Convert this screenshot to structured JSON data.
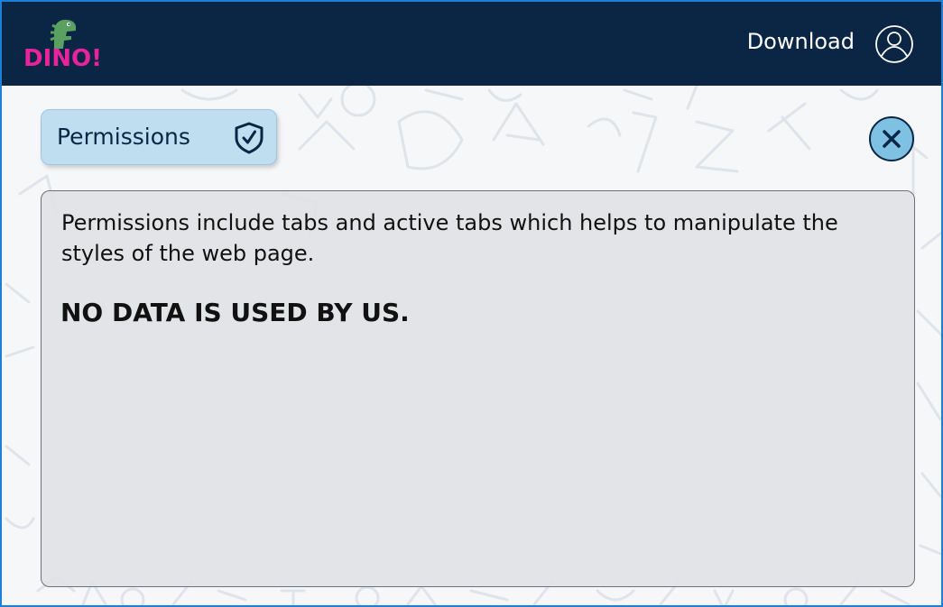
{
  "header": {
    "logo_text": "DINO!",
    "download_label": "Download"
  },
  "permissions_tab": {
    "label": "Permissions"
  },
  "content": {
    "description": "Permissions include tabs and active tabs which helps to manipulate the styles of the web page.",
    "notice": "NO DATA IS USED BY US."
  },
  "icons": {
    "logo": "dino-icon",
    "user": "user-circle-icon",
    "permissions": "shield-check-icon",
    "close": "close-icon"
  },
  "colors": {
    "header_bg": "#0b2545",
    "logo_pink": "#e8239b",
    "dino_green": "#5aa060",
    "tab_bg": "#bfdff1",
    "close_bg": "#7fc1e3",
    "card_bg": "#e1e2e5",
    "frame_border": "#1e7fd6"
  }
}
